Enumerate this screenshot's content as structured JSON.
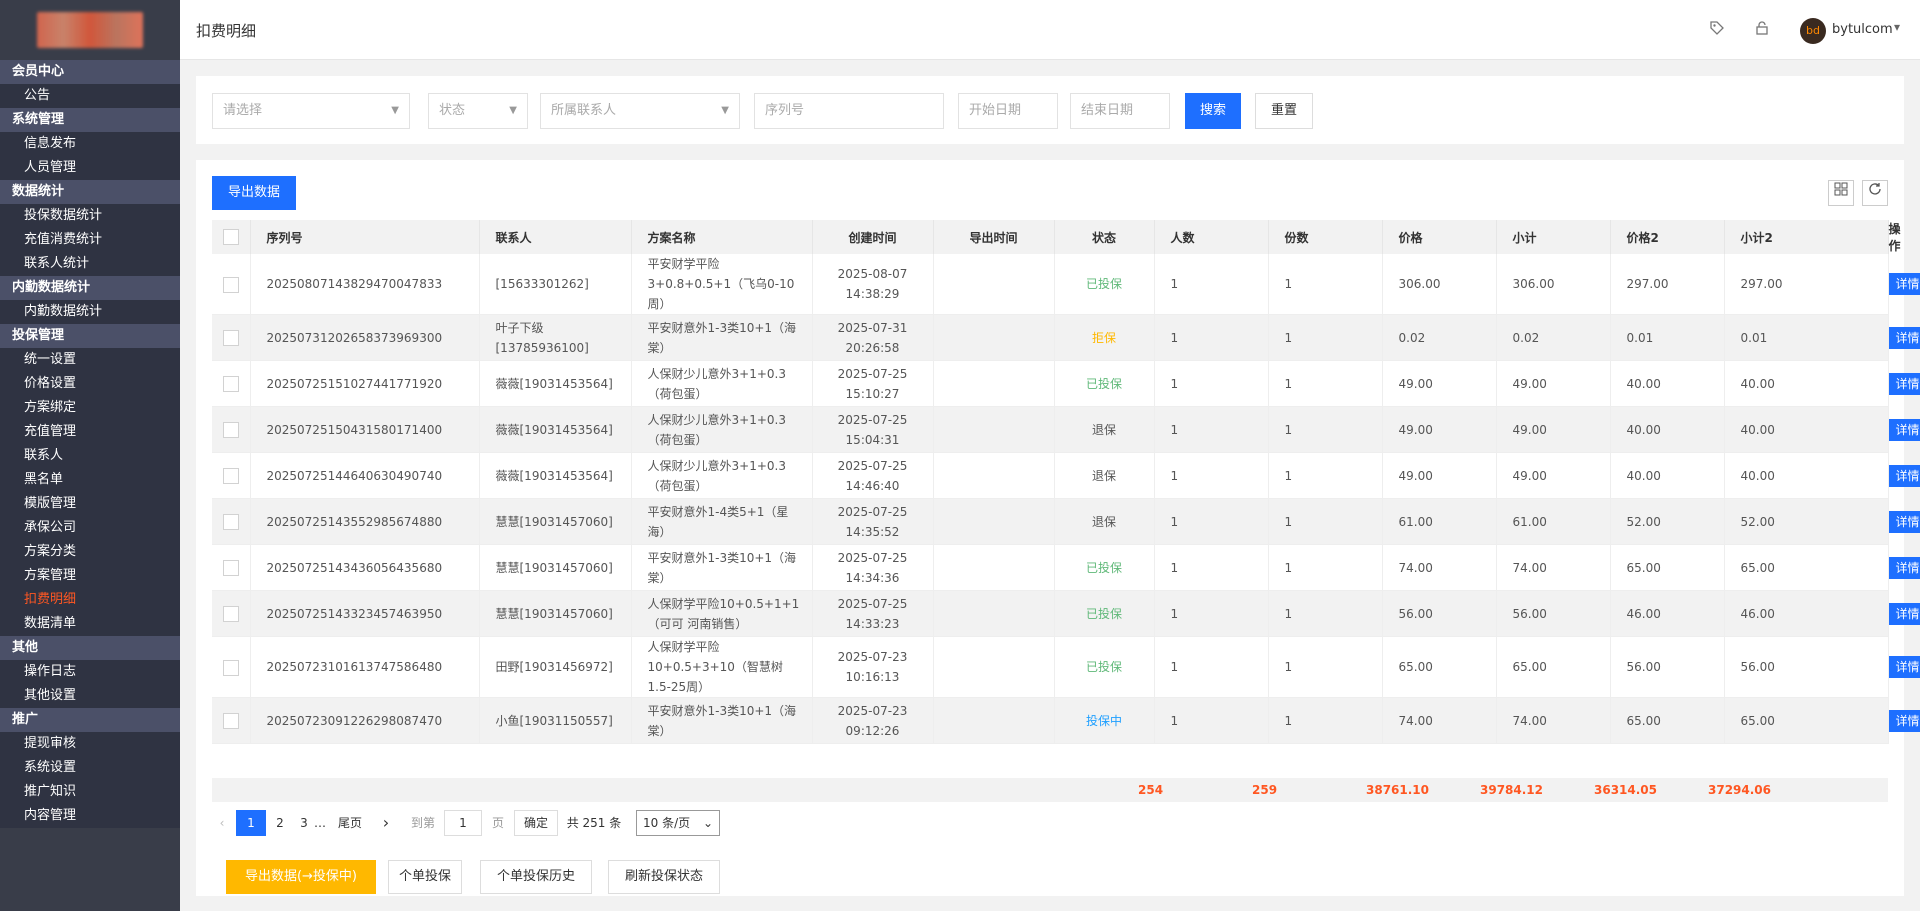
{
  "sidebar": {
    "groups": [
      {
        "title": "会员中心",
        "items": [
          "公告"
        ]
      },
      {
        "title": "系统管理",
        "items": [
          "信息发布",
          "人员管理"
        ]
      },
      {
        "title": "数据统计",
        "items": [
          "投保数据统计",
          "充值消费统计",
          "联系人统计"
        ]
      },
      {
        "title": "内勤数据统计",
        "items": [
          "内勤数据统计"
        ]
      },
      {
        "title": "投保管理",
        "items": [
          "统一设置",
          "价格设置",
          "方案绑定",
          "充值管理",
          "联系人",
          "黑名单",
          "模版管理",
          "承保公司",
          "方案分类",
          "方案管理",
          "扣费明细",
          "数据清单"
        ]
      },
      {
        "title": "其他",
        "items": [
          "操作日志",
          "其他设置"
        ]
      },
      {
        "title": "推广",
        "items": [
          "提现审核",
          "系统设置",
          "推广知识",
          "内容管理"
        ]
      }
    ],
    "active_item": "扣费明细"
  },
  "header": {
    "title": "扣费明细",
    "username": "bytulcom",
    "avatar_text": "bd"
  },
  "filters": {
    "select1": "请选择",
    "status": "状态",
    "contact": "所属联系人",
    "serial": "序列号",
    "start_date": "开始日期",
    "end_date": "结束日期",
    "search": "搜索",
    "reset": "重置"
  },
  "toolbar": {
    "export": "导出数据"
  },
  "table": {
    "columns": [
      "序列号",
      "联系人",
      "方案名称",
      "创建时间",
      "导出时间",
      "状态",
      "人数",
      "份数",
      "价格",
      "小计",
      "价格2",
      "小计2",
      "操作"
    ],
    "detail_label": "详情",
    "rows": [
      {
        "serial": "20250807143829470047833",
        "contact": "[15633301262]",
        "plan": "平安财学平险3+0.8+0.5+1（飞乌0-10周）",
        "date": "2025-08-07",
        "time": "14:38:29",
        "export": "",
        "status": "已投保",
        "people": "1",
        "copies": "1",
        "price": "306.00",
        "subtotal": "306.00",
        "price2": "297.00",
        "subtotal2": "297.00"
      },
      {
        "serial": "20250731202658373969300",
        "contact": "叶子下级[13785936100]",
        "plan": "平安财意外1-3类10+1（海棠）",
        "date": "2025-07-31",
        "time": "20:26:58",
        "export": "",
        "status": "拒保",
        "people": "1",
        "copies": "1",
        "price": "0.02",
        "subtotal": "0.02",
        "price2": "0.01",
        "subtotal2": "0.01"
      },
      {
        "serial": "20250725151027441771920",
        "contact": "薇薇[19031453564]",
        "plan": "人保财少儿意外3+1+0.3（荷包蛋）",
        "date": "2025-07-25",
        "time": "15:10:27",
        "export": "",
        "status": "已投保",
        "people": "1",
        "copies": "1",
        "price": "49.00",
        "subtotal": "49.00",
        "price2": "40.00",
        "subtotal2": "40.00"
      },
      {
        "serial": "20250725150431580171400",
        "contact": "薇薇[19031453564]",
        "plan": "人保财少儿意外3+1+0.3（荷包蛋）",
        "date": "2025-07-25",
        "time": "15:04:31",
        "export": "",
        "status": "退保",
        "people": "1",
        "copies": "1",
        "price": "49.00",
        "subtotal": "49.00",
        "price2": "40.00",
        "subtotal2": "40.00"
      },
      {
        "serial": "20250725144640630490740",
        "contact": "薇薇[19031453564]",
        "plan": "人保财少儿意外3+1+0.3（荷包蛋）",
        "date": "2025-07-25",
        "time": "14:46:40",
        "export": "",
        "status": "退保",
        "people": "1",
        "copies": "1",
        "price": "49.00",
        "subtotal": "49.00",
        "price2": "40.00",
        "subtotal2": "40.00"
      },
      {
        "serial": "20250725143552985674880",
        "contact": "慧慧[19031457060]",
        "plan": "平安财意外1-4类5+1（星海）",
        "date": "2025-07-25",
        "time": "14:35:52",
        "export": "",
        "status": "退保",
        "people": "1",
        "copies": "1",
        "price": "61.00",
        "subtotal": "61.00",
        "price2": "52.00",
        "subtotal2": "52.00"
      },
      {
        "serial": "20250725143436056435680",
        "contact": "慧慧[19031457060]",
        "plan": "平安财意外1-3类10+1（海棠）",
        "date": "2025-07-25",
        "time": "14:34:36",
        "export": "",
        "status": "已投保",
        "people": "1",
        "copies": "1",
        "price": "74.00",
        "subtotal": "74.00",
        "price2": "65.00",
        "subtotal2": "65.00"
      },
      {
        "serial": "20250725143323457463950",
        "contact": "慧慧[19031457060]",
        "plan": "人保财学平险10+0.5+1+1（可可 河南销售）",
        "date": "2025-07-25",
        "time": "14:33:23",
        "export": "",
        "status": "已投保",
        "people": "1",
        "copies": "1",
        "price": "56.00",
        "subtotal": "56.00",
        "price2": "46.00",
        "subtotal2": "46.00"
      },
      {
        "serial": "20250723101613747586480",
        "contact": "田野[19031456972]",
        "plan": "人保财学平险10+0.5+3+10（智慧树1.5-25周）",
        "date": "2025-07-23",
        "time": "10:16:13",
        "export": "",
        "status": "已投保",
        "people": "1",
        "copies": "1",
        "price": "65.00",
        "subtotal": "65.00",
        "price2": "56.00",
        "subtotal2": "56.00"
      },
      {
        "serial": "20250723091226298087470",
        "contact": "小鱼[19031150557]",
        "plan": "平安财意外1-3类10+1（海棠）",
        "date": "2025-07-23",
        "time": "09:12:26",
        "export": "",
        "status": "投保中",
        "people": "1",
        "copies": "1",
        "price": "74.00",
        "subtotal": "74.00",
        "price2": "65.00",
        "subtotal2": "65.00"
      }
    ],
    "totals": {
      "people": "254",
      "copies": "259",
      "price": "38761.10",
      "subtotal": "39784.12",
      "price2": "36314.05",
      "subtotal2": "37294.06"
    }
  },
  "status_colors": {
    "已投保": "#5FB878",
    "拒保": "#FFB800",
    "退保": "#555555",
    "投保中": "#1E9FFF"
  },
  "pager": {
    "pages": [
      "1",
      "2",
      "3"
    ],
    "ellipsis": "…",
    "last": "尾页",
    "goto_prefix": "到第",
    "goto_value": "1",
    "goto_suffix": "页",
    "confirm": "确定",
    "total": "共 251 条",
    "page_size": "10 条/页"
  },
  "actions": {
    "export_insuring": "导出数据(→投保中)",
    "single_insure": "个单投保",
    "single_history": "个单投保历史",
    "refresh_status": "刷新投保状态"
  }
}
